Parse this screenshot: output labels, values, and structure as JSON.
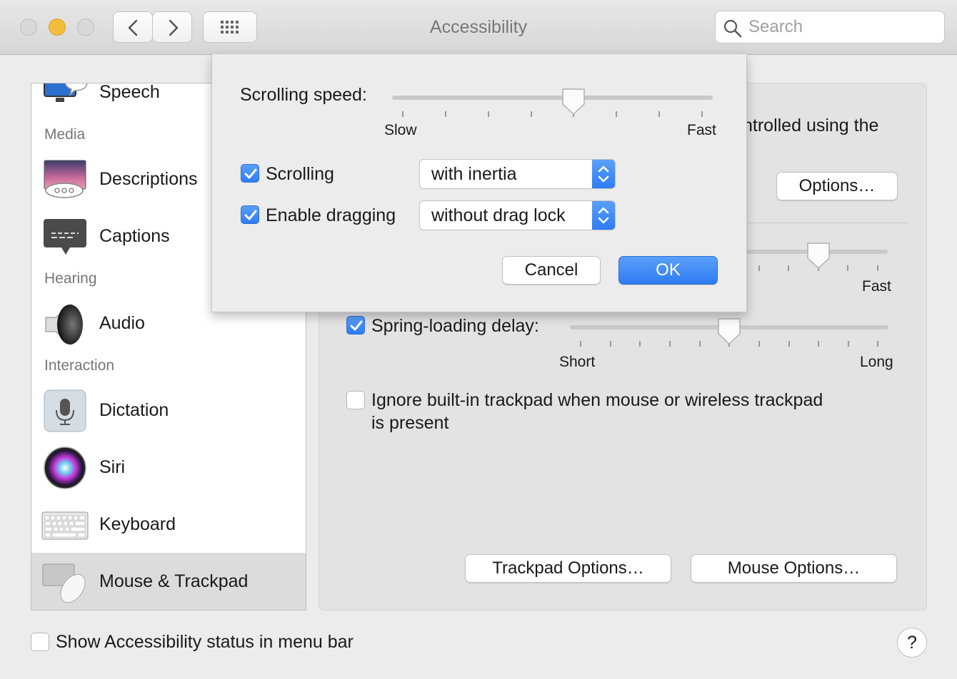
{
  "window": {
    "title": "Accessibility"
  },
  "search": {
    "placeholder": "Search"
  },
  "sidebar": {
    "items": [
      {
        "label": "Speech",
        "icon": "speech-icon"
      },
      {
        "section": "Media"
      },
      {
        "label": "Descriptions",
        "icon": "descriptions-icon"
      },
      {
        "label": "Captions",
        "icon": "captions-icon"
      },
      {
        "section": "Hearing"
      },
      {
        "label": "Audio",
        "icon": "speaker-icon"
      },
      {
        "section": "Interaction"
      },
      {
        "label": "Dictation",
        "icon": "microphone-icon"
      },
      {
        "label": "Siri",
        "icon": "siri-icon"
      },
      {
        "label": "Keyboard",
        "icon": "keyboard-icon"
      },
      {
        "label": "Mouse & Trackpad",
        "icon": "mouse-trackpad-icon",
        "selected": true
      }
    ]
  },
  "panel": {
    "partial_text": "ntrolled using the",
    "options_button": "Options…",
    "speed_fast_label": "Fast",
    "speed_slider_value": 0.78,
    "spring_loading": {
      "label": "Spring-loading delay:",
      "checked": true,
      "min_label": "Short",
      "max_label": "Long",
      "value": 0.5
    },
    "ignore_trackpad": {
      "label_line1": "Ignore built-in trackpad when mouse or wireless trackpad",
      "label_line2": "is present",
      "checked": false
    },
    "trackpad_options_button": "Trackpad Options…",
    "mouse_options_button": "Mouse Options…"
  },
  "sheet": {
    "scrolling_speed_label": "Scrolling speed:",
    "speed_min_label": "Slow",
    "speed_max_label": "Fast",
    "scrolling_speed_value": 0.56,
    "scrolling": {
      "label": "Scrolling",
      "checked": true,
      "selected": "with inertia"
    },
    "dragging": {
      "label": "Enable dragging",
      "checked": true,
      "selected": "without drag lock"
    },
    "cancel_button": "Cancel",
    "ok_button": "OK"
  },
  "footer": {
    "status_checkbox_label": "Show Accessibility status in menu bar",
    "status_checked": false,
    "help": "?"
  },
  "colors": {
    "accent": "#2f7cf4",
    "close": "#d4d4d4",
    "minimize": "#f5bd3a",
    "zoom": "#d4d4d4"
  }
}
